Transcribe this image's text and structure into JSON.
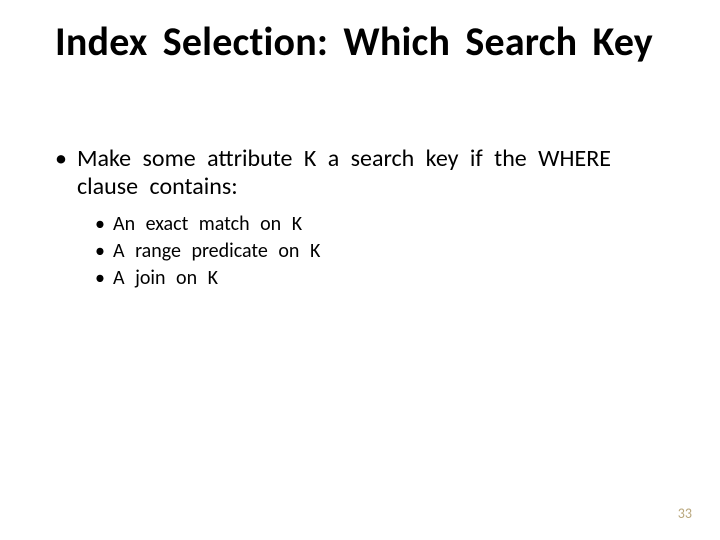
{
  "title": "Index  Selection:  Which  Search Key",
  "main_bullet": "Make  some  attribute  K  a  search  key  if  the WHERE  clause  contains:",
  "sub_bullets": [
    "An  exact  match  on  K",
    "A  range  predicate  on  K",
    "A  join  on  K"
  ],
  "page_number": "33"
}
